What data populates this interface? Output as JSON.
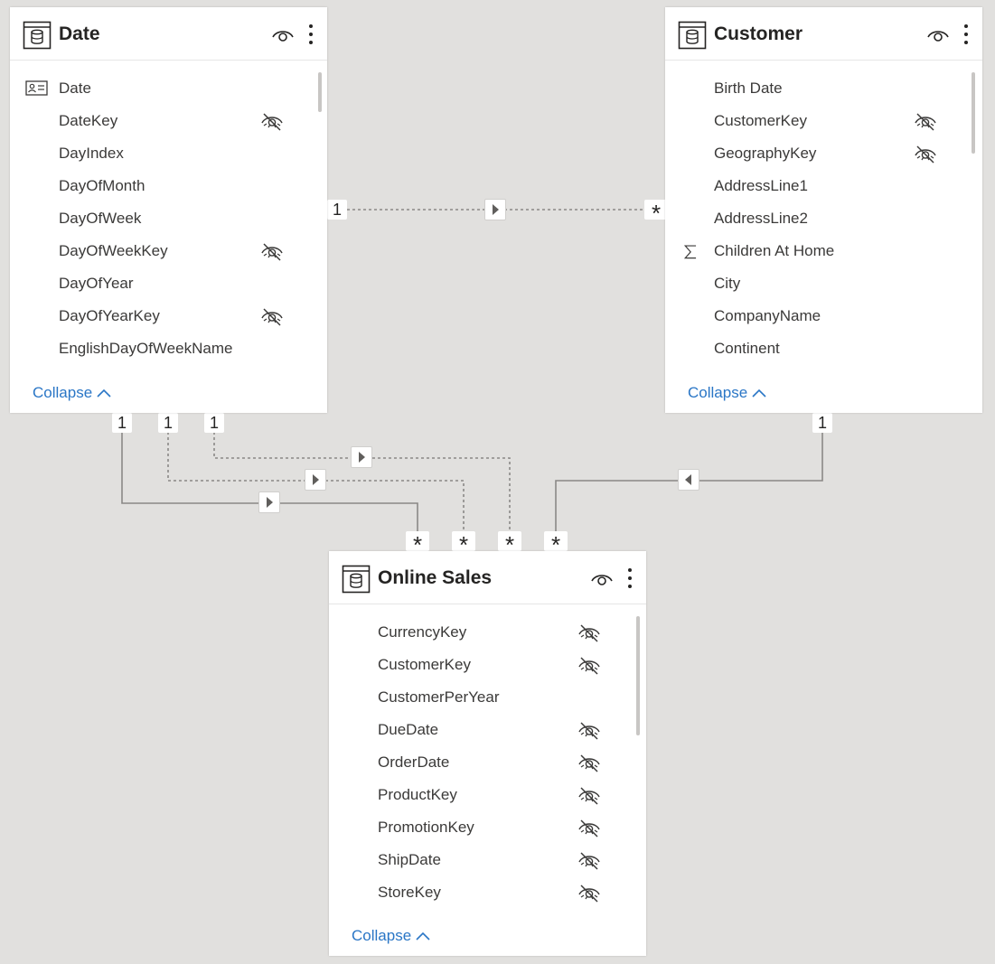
{
  "tables": {
    "date": {
      "title": "Date",
      "fields": [
        {
          "name": "Date",
          "icon": "date-hierarchy-icon",
          "hidden": false
        },
        {
          "name": "DateKey",
          "icon": "",
          "hidden": true
        },
        {
          "name": "DayIndex",
          "icon": "",
          "hidden": false
        },
        {
          "name": "DayOfMonth",
          "icon": "",
          "hidden": false
        },
        {
          "name": "DayOfWeek",
          "icon": "",
          "hidden": false
        },
        {
          "name": "DayOfWeekKey",
          "icon": "",
          "hidden": true
        },
        {
          "name": "DayOfYear",
          "icon": "",
          "hidden": false
        },
        {
          "name": "DayOfYearKey",
          "icon": "",
          "hidden": true
        },
        {
          "name": "EnglishDayOfWeekName",
          "icon": "",
          "hidden": false
        }
      ],
      "collapse_label": "Collapse"
    },
    "customer": {
      "title": "Customer",
      "fields": [
        {
          "name": "Birth Date",
          "icon": "",
          "hidden": false
        },
        {
          "name": "CustomerKey",
          "icon": "",
          "hidden": true
        },
        {
          "name": "GeographyKey",
          "icon": "",
          "hidden": true
        },
        {
          "name": "AddressLine1",
          "icon": "",
          "hidden": false
        },
        {
          "name": "AddressLine2",
          "icon": "",
          "hidden": false
        },
        {
          "name": "Children At Home",
          "icon": "sigma-icon",
          "hidden": false
        },
        {
          "name": "City",
          "icon": "",
          "hidden": false
        },
        {
          "name": "CompanyName",
          "icon": "",
          "hidden": false
        },
        {
          "name": "Continent",
          "icon": "",
          "hidden": false
        }
      ],
      "collapse_label": "Collapse"
    },
    "online_sales": {
      "title": "Online Sales",
      "fields": [
        {
          "name": "CurrencyKey",
          "icon": "",
          "hidden": true
        },
        {
          "name": "CustomerKey",
          "icon": "",
          "hidden": true
        },
        {
          "name": "CustomerPerYear",
          "icon": "",
          "hidden": false
        },
        {
          "name": "DueDate",
          "icon": "",
          "hidden": true
        },
        {
          "name": "OrderDate",
          "icon": "",
          "hidden": true
        },
        {
          "name": "ProductKey",
          "icon": "",
          "hidden": true
        },
        {
          "name": "PromotionKey",
          "icon": "",
          "hidden": true
        },
        {
          "name": "ShipDate",
          "icon": "",
          "hidden": true
        },
        {
          "name": "StoreKey",
          "icon": "",
          "hidden": true
        }
      ],
      "collapse_label": "Collapse"
    }
  },
  "relationships": [
    {
      "from": "Date",
      "to": "Customer",
      "from_cardinality": "1",
      "to_cardinality": "*",
      "active": false
    },
    {
      "from": "Date",
      "to": "Online Sales",
      "from_cardinality": "1",
      "to_cardinality": "*",
      "active": true
    },
    {
      "from": "Date",
      "to": "Online Sales",
      "from_cardinality": "1",
      "to_cardinality": "*",
      "active": false
    },
    {
      "from": "Date",
      "to": "Online Sales",
      "from_cardinality": "1",
      "to_cardinality": "*",
      "active": false
    },
    {
      "from": "Customer",
      "to": "Online Sales",
      "from_cardinality": "1",
      "to_cardinality": "*",
      "active": true
    }
  ],
  "colors": {
    "canvas": "#e1e0de",
    "card": "#ffffff",
    "link": "#2a76c6",
    "relationship_line": "#8a8886"
  }
}
